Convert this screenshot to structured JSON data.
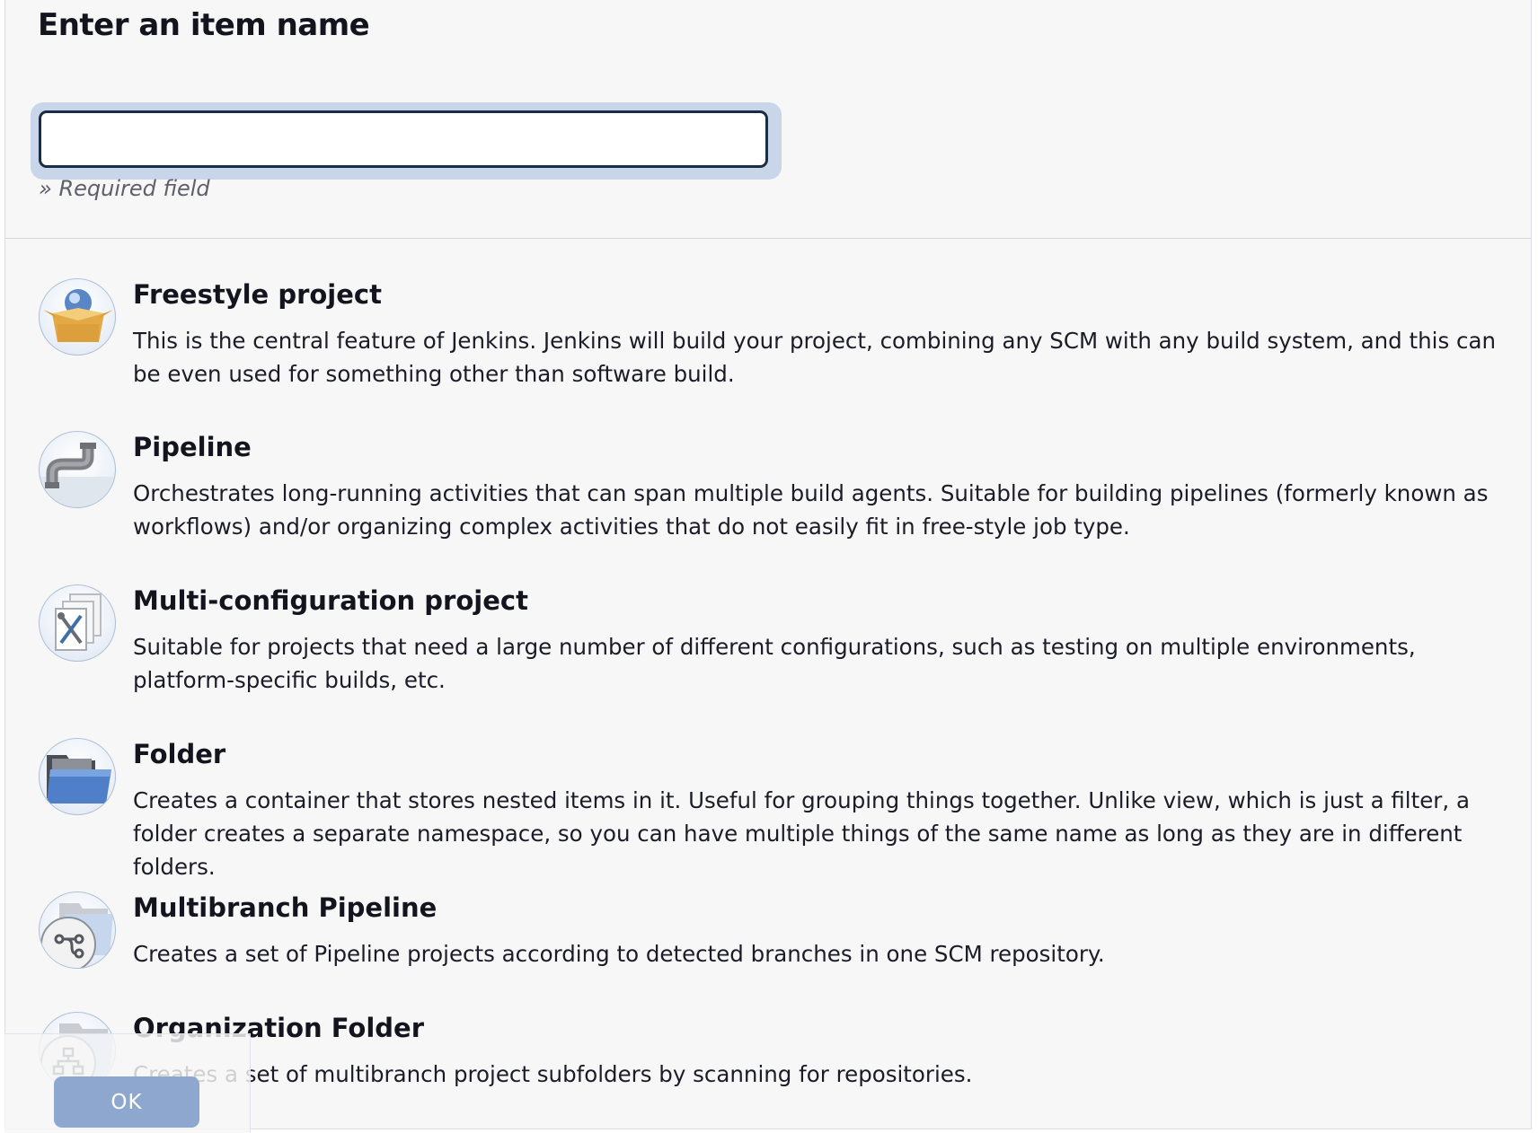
{
  "header": {
    "title": "Enter an item name",
    "name_input": {
      "value": "",
      "placeholder": ""
    },
    "required_note": "» Required field"
  },
  "item_types": [
    {
      "title": "Freestyle project",
      "description": "This is the central feature of Jenkins. Jenkins will build your project, combining any SCM with any build system, and this can be even used for something other than software build.",
      "icon": "freestyle-box-icon"
    },
    {
      "title": "Pipeline",
      "description": "Orchestrates long-running activities that can span multiple build agents. Suitable for building pipelines (formerly known as workflows) and/or organizing complex activities that do not easily fit in free-style job type.",
      "icon": "pipe-icon"
    },
    {
      "title": "Multi-configuration project",
      "description": "Suitable for projects that need a large number of different configurations, such as testing on multiple environments, platform-specific builds, etc.",
      "icon": "multi-config-tools-icon"
    },
    {
      "title": "Folder",
      "description": "Creates a container that stores nested items in it. Useful for grouping things together. Unlike view, which is just a filter, a folder creates a separate namespace, so you can have multiple things of the same name as long as they are in different folders.",
      "icon": "folder-icon"
    },
    {
      "title": "Multibranch Pipeline",
      "description": "Creates a set of Pipeline projects according to detected branches in one SCM repository.",
      "icon": "multibranch-icon"
    },
    {
      "title": "Organization Folder",
      "description": "Creates a set of multibranch project subfolders by scanning for repositories.",
      "icon": "organization-folder-icon"
    }
  ],
  "footer": {
    "ok_label": "OK"
  },
  "colors": {
    "accent": "#8ea7cf",
    "input_focus_ring": "#c9d6ea",
    "input_border": "#1b2d44",
    "page_bg": "#f7f7f8"
  }
}
